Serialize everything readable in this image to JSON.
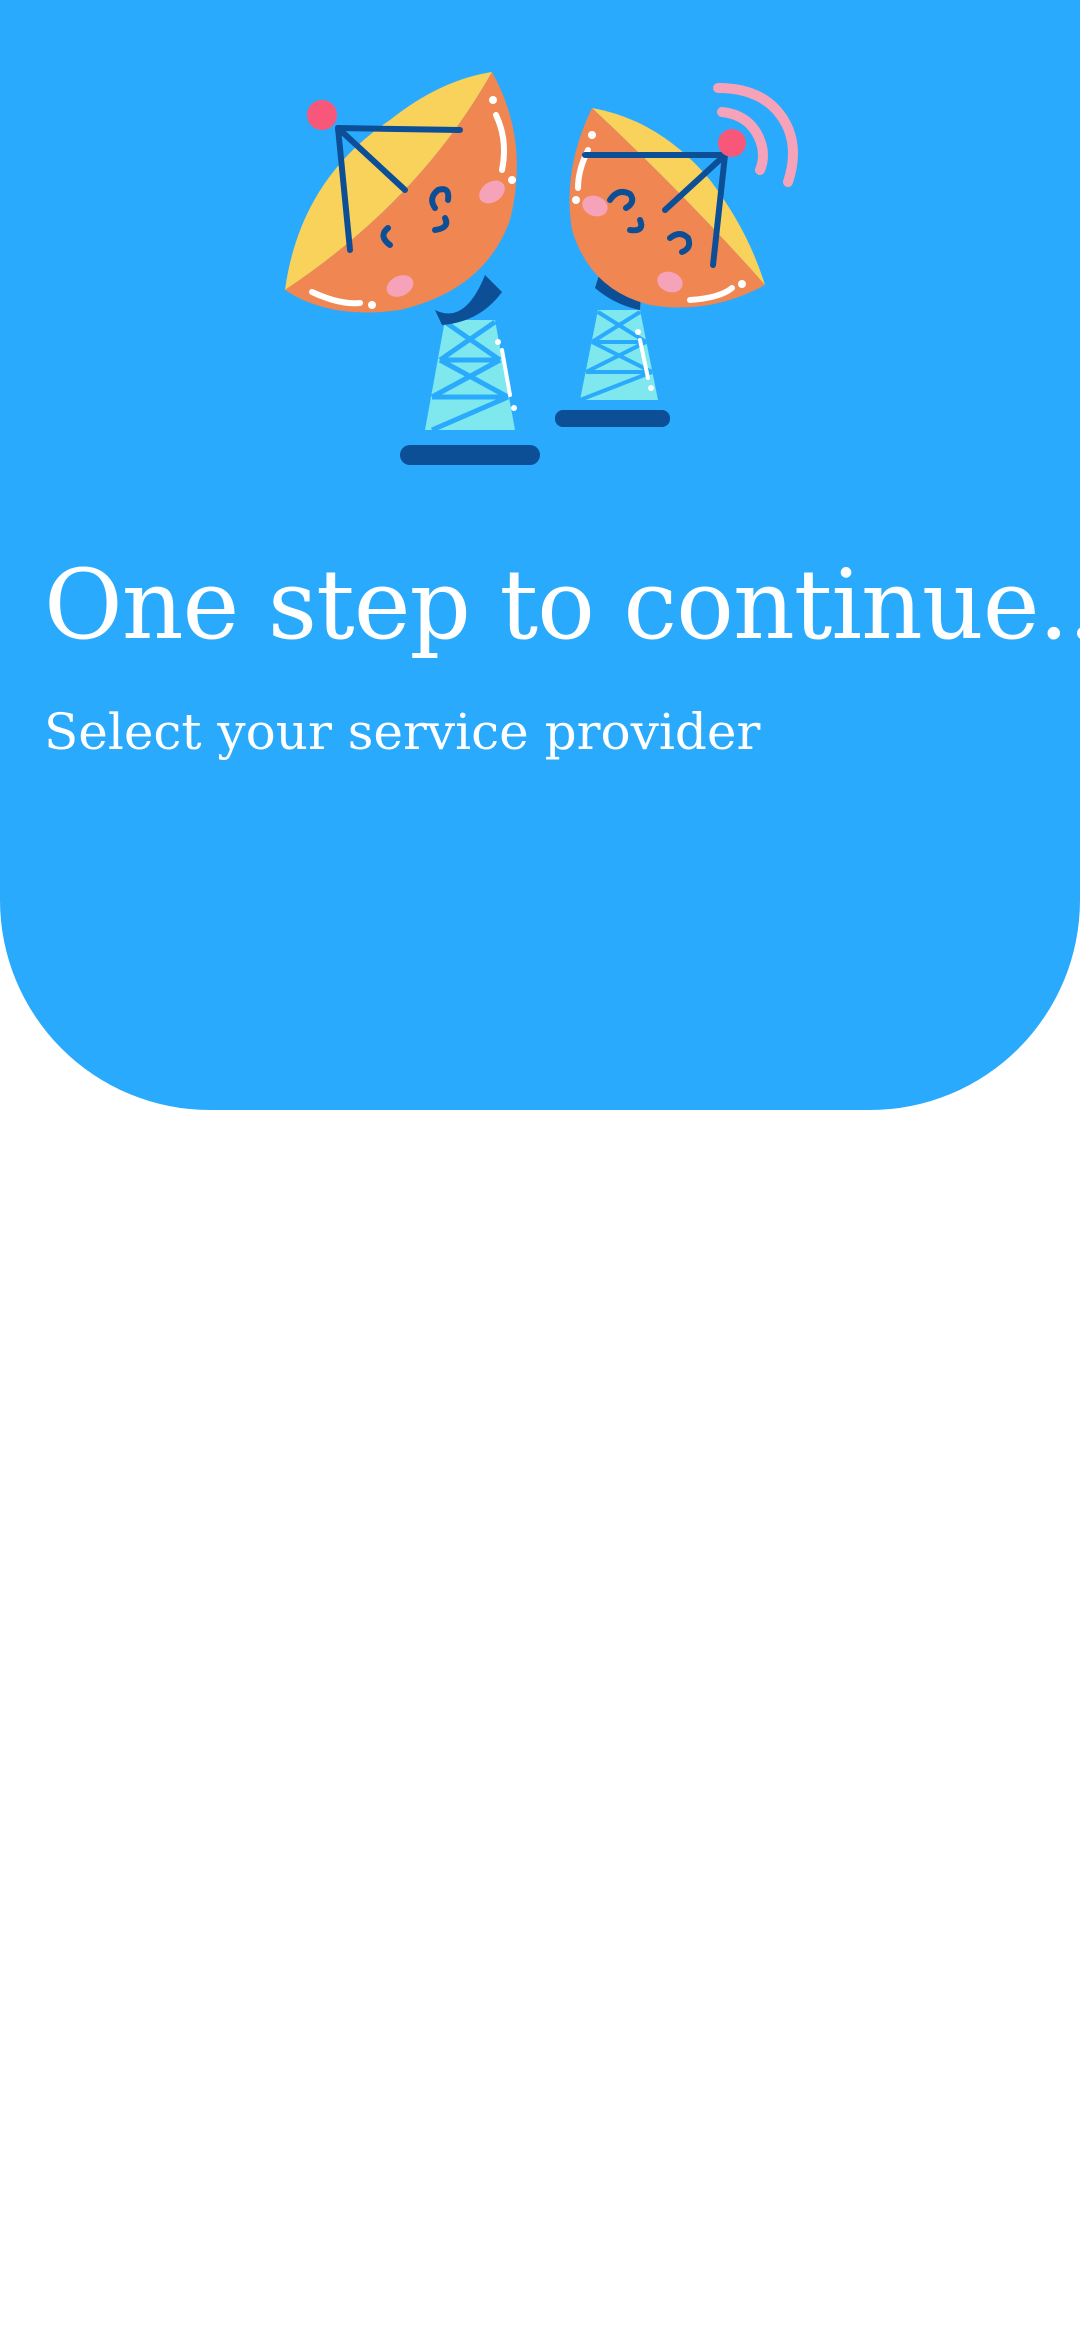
{
  "colors": {
    "hero_background": "#2aaafc",
    "page_background": "#ffffff",
    "text": "#ffffff",
    "dish_orange": "#f08651",
    "dish_yellow": "#f9d25c",
    "tower_cyan": "#7ee8ee",
    "dark_blue": "#0d4f97",
    "signal_pink": "#f6a2b8",
    "tip_pink": "#f7587a"
  },
  "illustration": {
    "icon": "satellite-dishes-illustration"
  },
  "onboarding": {
    "title": "One step to continue...",
    "subtitle": "Select your service provider"
  }
}
